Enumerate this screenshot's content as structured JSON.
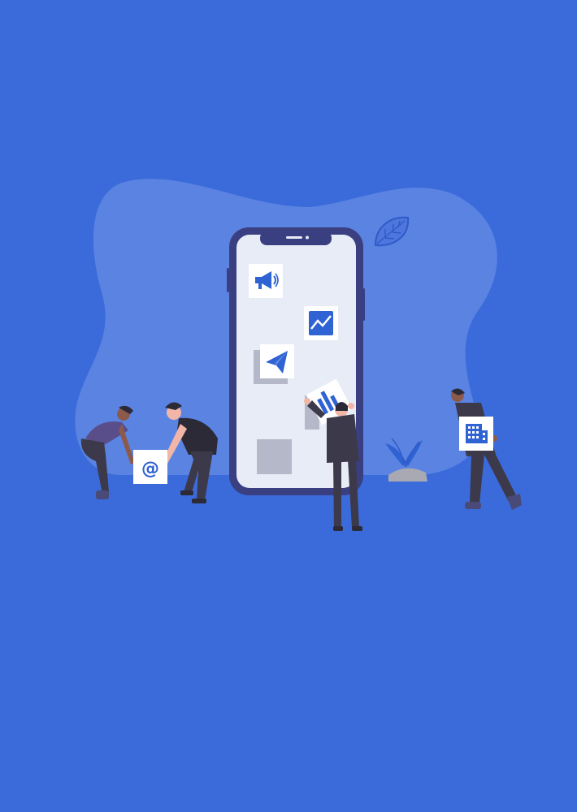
{
  "scene": {
    "background_color": "#3B6BDA",
    "blob_color": "#5A83E2",
    "phone_frame_color": "#3A3F82",
    "phone_screen_color": "#E8ECF6",
    "icon_color": "#2F62D2",
    "card_shadow_color": "#B5B8C8",
    "figure_color": "#3C3A4A",
    "skin_color": "#F2B6A8",
    "icons": [
      "megaphone-icon",
      "analytics-chart-icon",
      "paper-plane-icon",
      "bar-chart-icon",
      "at-sign-icon",
      "office-building-icon",
      "leaf-icon",
      "plant-icon"
    ]
  },
  "email_card": {
    "symbol": "@"
  }
}
